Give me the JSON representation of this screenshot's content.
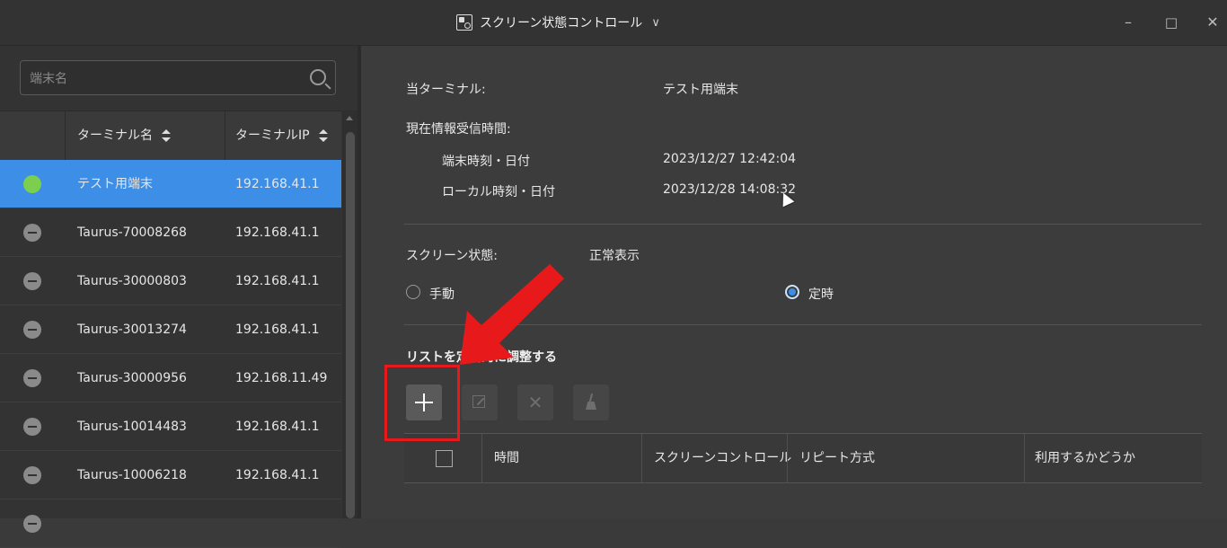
{
  "window": {
    "title": "スクリーン状態コントロール",
    "chevron": "∨",
    "minimize": "–",
    "maximize": "□",
    "close": "✕"
  },
  "sidebar": {
    "search_placeholder": "端末名",
    "columns": {
      "name": "ターミナル名",
      "ip": "ターミナルIP"
    },
    "terminals": [
      {
        "status": "online",
        "name": "テスト用端末",
        "ip": "192.168.41.1",
        "selected": true
      },
      {
        "status": "offline",
        "name": "Taurus-70008268",
        "ip": "192.168.41.1",
        "selected": false
      },
      {
        "status": "offline",
        "name": "Taurus-30000803",
        "ip": "192.168.41.1",
        "selected": false
      },
      {
        "status": "offline",
        "name": "Taurus-30013274",
        "ip": "192.168.41.1",
        "selected": false
      },
      {
        "status": "offline",
        "name": "Taurus-30000956",
        "ip": "192.168.11.49",
        "selected": false
      },
      {
        "status": "offline",
        "name": "Taurus-10014483",
        "ip": "192.168.41.1",
        "selected": false
      },
      {
        "status": "offline",
        "name": "Taurus-10006218",
        "ip": "192.168.41.1",
        "selected": false
      }
    ]
  },
  "details": {
    "current_terminal_label": "当ターミナル:",
    "current_terminal_value": "テスト用端末",
    "received_time_label": "現在情報受信時間:",
    "terminal_time_label": "端末時刻・日付",
    "terminal_time_value": "2023/12/27 12:42:04",
    "local_time_label": "ローカル時刻・日付",
    "local_time_value": "2023/12/28 14:08:32",
    "screen_state_label": "スクリーン状態:",
    "screen_state_value": "正常表示",
    "mode_manual": "手動",
    "mode_scheduled": "定時",
    "selected_mode": "定時"
  },
  "schedule": {
    "section_title": "リストを定期的に調整する",
    "columns": [
      "時間",
      "スクリーンコントロール",
      "リピート方式",
      "利用するかどうか"
    ]
  },
  "colors": {
    "accent": "#3c8ee6",
    "online": "#7ccf4e",
    "highlight": "#e8191a"
  }
}
